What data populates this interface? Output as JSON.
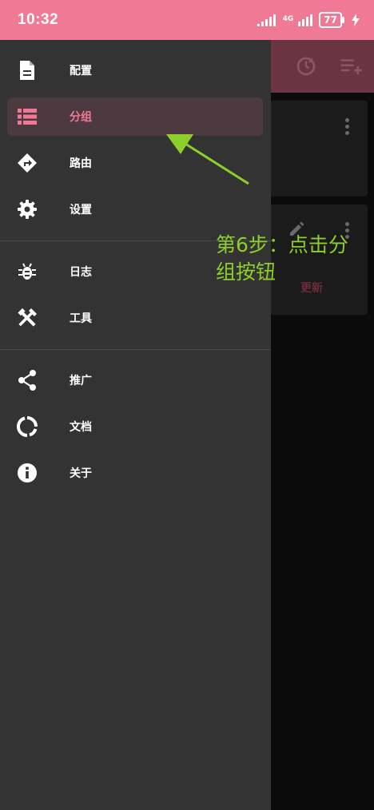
{
  "status_bar": {
    "time": "10:32",
    "network": "4G",
    "battery": "77"
  },
  "drawer": {
    "items": [
      {
        "label": "配置",
        "icon": "document-icon"
      },
      {
        "label": "分组",
        "icon": "list-icon",
        "active": true
      },
      {
        "label": "路由",
        "icon": "route-diamond-icon"
      },
      {
        "label": "设置",
        "icon": "gear-icon"
      },
      {
        "label": "日志",
        "icon": "bug-icon"
      },
      {
        "label": "工具",
        "icon": "tools-icon"
      },
      {
        "label": "推广",
        "icon": "share-icon"
      },
      {
        "label": "文档",
        "icon": "donut-icon"
      },
      {
        "label": "关于",
        "icon": "info-icon"
      }
    ]
  },
  "background": {
    "update_label": "更新",
    "toolbar_icons": [
      "refresh-icon",
      "playlist-add-icon"
    ]
  },
  "annotation": {
    "text": "第6步：点击分组按钮"
  },
  "colors": {
    "accent": "#f07a96",
    "drawer_bg": "#333333",
    "annotation": "#8ccf2a"
  }
}
